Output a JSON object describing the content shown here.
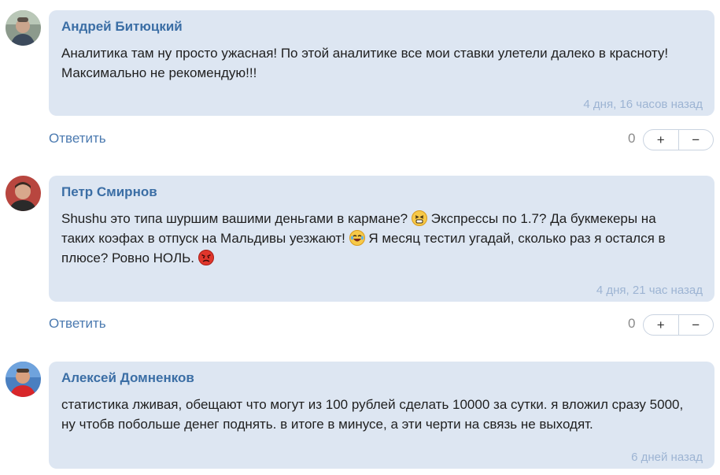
{
  "comments": [
    {
      "author": "Андрей Битюцкий",
      "lines": [
        "Аналитика там ну просто ужасная! По этой аналитике все мои ставки улетели далеко в красноту!",
        "Максимально не рекомендую!!!"
      ],
      "time": "4 дня, 16 часов назад",
      "reply_label": "Ответить",
      "votes": "0",
      "plus": "+",
      "minus": "−",
      "avatar_icon": "user-avatar-photo"
    },
    {
      "author": "Петр Смирнов",
      "lines": [
        "Shushu это типа шуршим вашими деньгами в кармане?",
        "Экспрессы по 1.7? Да букмекеры на",
        "таких коэфах в отпуск на Мальдивы уезжают!",
        "Я месяц тестил угадай, сколько раз я остался в",
        "плюсе? Ровно НОЛЬ."
      ],
      "time": "4 дня, 21 час назад",
      "reply_label": "Ответить",
      "votes": "0",
      "plus": "+",
      "minus": "−",
      "avatar_icon": "user-avatar-photo"
    },
    {
      "author": "Алексей Домненков",
      "lines": [
        "статистика лживая, обещают что могут из 100 рублей сделать 10000 за сутки. я вложил сразу 5000,",
        "ну чтобв побольше денег поднять. в итоге в минусе, а эти черти на связь не выходят."
      ],
      "time": "6 дней назад",
      "avatar_icon": "user-avatar-photo"
    }
  ],
  "colors": {
    "bubble": "#dde6f2",
    "author": "#3b6ea5",
    "time": "#9db4d3",
    "reply": "#4b7ab0"
  }
}
